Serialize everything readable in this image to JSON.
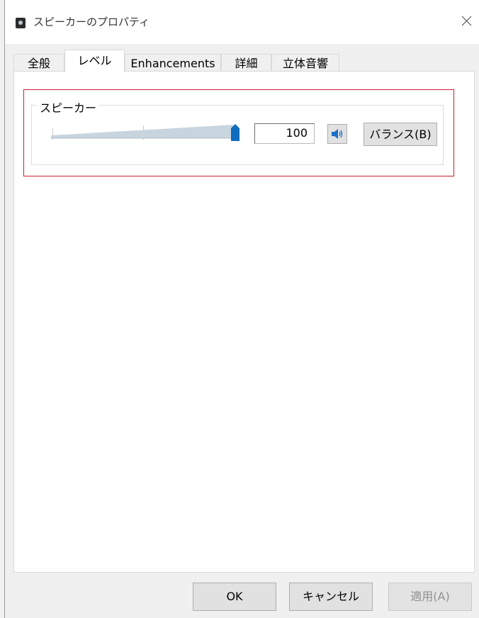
{
  "window": {
    "title": "スピーカーのプロパティ",
    "icon": "speaker-device-icon",
    "close_icon": "close-icon"
  },
  "tabs": [
    {
      "label": "全般",
      "active": false
    },
    {
      "label": "レベル",
      "active": true
    },
    {
      "label": "Enhancements",
      "active": false
    },
    {
      "label": "詳細",
      "active": false
    },
    {
      "label": "立体音響",
      "active": false
    }
  ],
  "level": {
    "group_label": "スピーカー",
    "volume_value": "100",
    "volume_level_percent": 100,
    "mute_icon": "speaker-volume-icon",
    "balance_label": "バランス(B)"
  },
  "footer": {
    "ok_label": "OK",
    "cancel_label": "キャンセル",
    "apply_label": "適用(A)",
    "apply_enabled": false
  },
  "colors": {
    "highlight_border": "#cc1f30",
    "slider_thumb": "#0f6cbd",
    "slider_track": "#c9d5de"
  }
}
